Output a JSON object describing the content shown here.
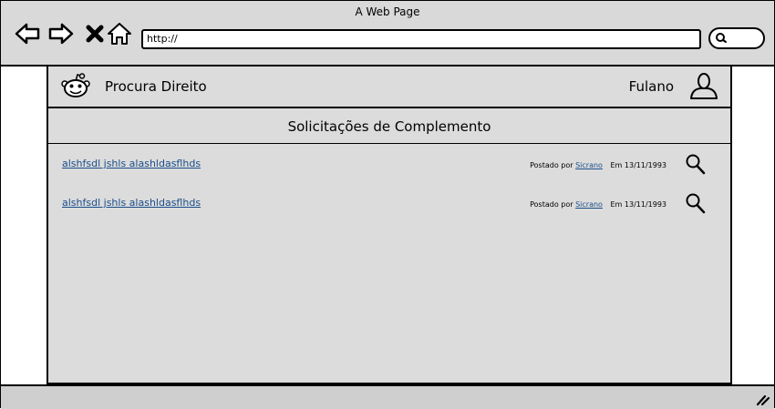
{
  "window": {
    "title": "A Web Page"
  },
  "browser": {
    "url": "http://",
    "nav_icons": [
      "back-arrow-icon",
      "forward-arrow-icon",
      "close-x-icon",
      "home-icon"
    ],
    "search_icon": "search-icon"
  },
  "header": {
    "brand": "Procura Direito",
    "user_name": "Fulano",
    "logo_icon": "robot-logo-icon",
    "user_icon": "user-icon"
  },
  "section": {
    "title": "Solicitações de Complemento"
  },
  "rows": [
    {
      "title": "alshfsdl jshls alashldasflhds",
      "posted_by_label": "Postado por",
      "author": "Sicrano",
      "date_label": "Em 13/11/1993",
      "icon": "magnifier-icon"
    },
    {
      "title": "alshfsdl jshls alashldasflhds",
      "posted_by_label": "Postado por",
      "author": "Sicrano",
      "date_label": "Em 13/11/1993",
      "icon": "magnifier-icon"
    }
  ],
  "colors": {
    "chrome": "#d9d9d9",
    "content": "#dcdcdc",
    "link": "#1a4e8a"
  }
}
